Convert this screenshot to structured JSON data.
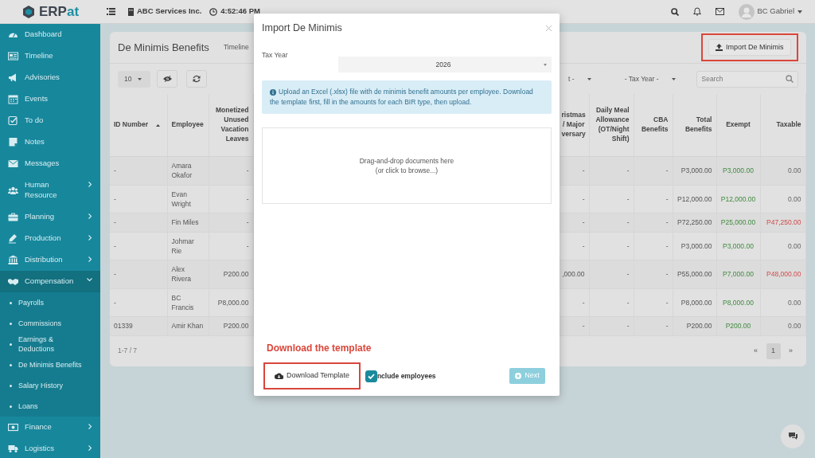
{
  "navbar": {
    "logo": {
      "primary": "ERP",
      "accent": "at"
    },
    "company": "ABC Services Inc.",
    "time": "4:52:46 PM",
    "user": "BC Gabriel"
  },
  "sidebar": {
    "items": [
      {
        "label": "Dashboard",
        "selected": false
      },
      {
        "label": "Timeline",
        "selected": false
      },
      {
        "label": "Advisories",
        "selected": false
      },
      {
        "label": "Events",
        "selected": false
      },
      {
        "label": "To do",
        "selected": false
      },
      {
        "label": "Notes",
        "selected": false
      },
      {
        "label": "Messages",
        "selected": false
      },
      {
        "label": "Human Resource",
        "selected": false,
        "expanded": false
      },
      {
        "label": "Planning",
        "selected": false,
        "expanded": false
      },
      {
        "label": "Production",
        "selected": false,
        "expanded": false
      },
      {
        "label": "Distribution",
        "selected": false,
        "expanded": false
      },
      {
        "label": "Compensation",
        "selected": true,
        "expanded": true,
        "children": [
          {
            "label": "Payrolls",
            "selected": false
          },
          {
            "label": "Commissions",
            "selected": false
          },
          {
            "label": "Earnings & Deductions",
            "selected": false
          },
          {
            "label": "De Minimis Benefits",
            "selected": false
          },
          {
            "label": "Salary History",
            "selected": false
          },
          {
            "label": "Loans",
            "selected": false
          }
        ]
      },
      {
        "label": "Finance",
        "selected": false,
        "expanded": false
      },
      {
        "label": "Logistics",
        "selected": false,
        "expanded": false
      }
    ]
  },
  "page": {
    "title": "De Minimis Benefits",
    "tabs": [
      {
        "label": "Timeline",
        "selected": false
      }
    ],
    "import_button": {
      "label": "Import De Minimis",
      "highlighted": true
    },
    "page_length": "10",
    "filters": [
      {
        "value": "t -"
      },
      {
        "value": "- Tax Year -"
      }
    ],
    "search": {
      "placeholder": "Search"
    },
    "table": {
      "columns": [
        {
          "label": "ID Number",
          "kind": "text",
          "sorted": true
        },
        {
          "label": "Employee",
          "kind": "text"
        },
        {
          "label": "Monetized Unused Vacation Leaves",
          "kind": "amount"
        },
        {
          "lines": [
            "ristmas",
            "/ Major",
            "versary"
          ],
          "kind": "cut"
        },
        {
          "label": "Daily Meal Allowance (OT/Night Shift)",
          "kind": "amount"
        },
        {
          "label": "CBA Benefits",
          "kind": "amount"
        },
        {
          "label": "Total Benefits",
          "kind": "amount"
        },
        {
          "label": "Exempt",
          "kind": "exempt"
        },
        {
          "label": "Taxable",
          "kind": "amount"
        }
      ],
      "rows": [
        {
          "cells": [
            "-",
            "Amara Okafor",
            "-",
            "-",
            "-",
            "-",
            "P3,000.00",
            "P3,000.00",
            "0.00"
          ],
          "taxable_flag": false
        },
        {
          "cells": [
            "-",
            "Evan Wright",
            "-",
            "-",
            "-",
            "-",
            "P12,000.00",
            "P12,000.00",
            "0.00"
          ],
          "taxable_flag": false
        },
        {
          "cells": [
            "-",
            "Fin Miles",
            "-",
            "-",
            "-",
            "-",
            "P72,250.00",
            "P25,000.00",
            "P47,250.00"
          ],
          "taxable_flag": true
        },
        {
          "cells": [
            "-",
            "Johmar Rie",
            "-",
            "-",
            "-",
            "-",
            "P3,000.00",
            "P3,000.00",
            "0.00"
          ],
          "taxable_flag": false
        },
        {
          "cells": [
            "-",
            "Alex Rivera",
            "P200.00",
            ",000.00",
            "-",
            "-",
            "P55,000.00",
            "P7,000.00",
            "P48,000.00"
          ],
          "taxable_flag": true
        },
        {
          "cells": [
            "-",
            "BC Francis",
            "P8,000.00",
            "-",
            "-",
            "-",
            "P8,000.00",
            "P8,000.00",
            "0.00"
          ],
          "taxable_flag": false
        },
        {
          "cells": [
            "01339",
            "Amir Khan",
            "P200.00",
            "-",
            "-",
            "-",
            "P200.00",
            "P200.00",
            "0.00"
          ],
          "taxable_flag": false
        }
      ]
    },
    "footer": {
      "summary": "1-7 / 7",
      "pages": [
        {
          "label": "«",
          "selected": false
        },
        {
          "label": "1",
          "selected": true
        },
        {
          "label": "»",
          "selected": false
        }
      ]
    }
  },
  "modal": {
    "title": "Import De Minimis",
    "fields": [
      {
        "label": "Tax Year",
        "value": "2026"
      }
    ],
    "info": "Upload an Excel (.xlsx) file with de minimis benefit amounts per employee. Download the template first, fill in the amounts for each BIR type, then upload.",
    "dropzone": [
      "Drag-and-drop documents here",
      "(or click to browse...)"
    ],
    "annotation": "Download the template",
    "download_button": {
      "label": "Download Template",
      "highlighted": true
    },
    "include_employees": {
      "label": "nclude employees",
      "checked": true
    },
    "next_button": {
      "label": "Next",
      "disabled": true
    }
  }
}
